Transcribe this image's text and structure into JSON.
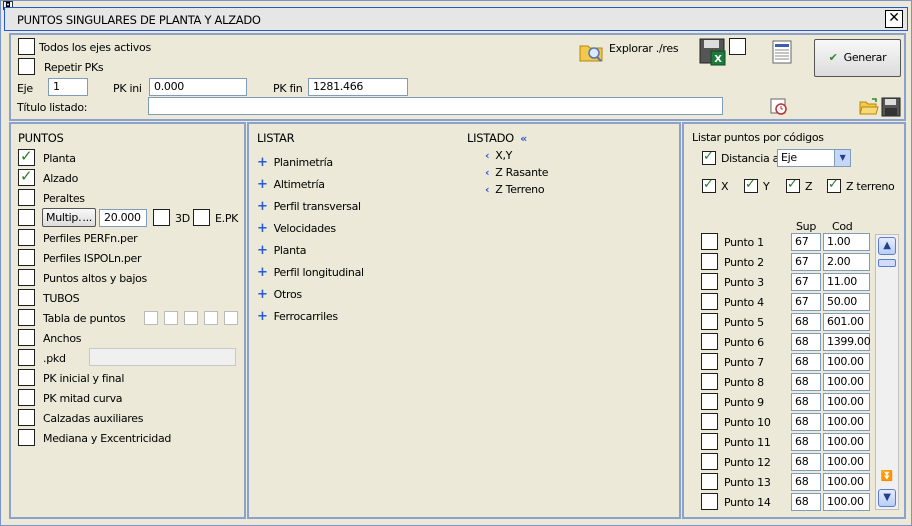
{
  "window": {
    "title": "PUNTOS SINGULARES DE PLANTA Y ALZADO"
  },
  "top": {
    "todos_ejes": "Todos los ejes activos",
    "repetir_pks": "Repetir PKs",
    "eje_label": "Eje",
    "eje_value": "1",
    "pk_ini_label": "PK ini",
    "pk_ini_value": "0.000",
    "pk_fin_label": "PK fin",
    "pk_fin_value": "1281.466",
    "titulo_label": "Título listado:",
    "titulo_value": "",
    "explorar_label": "Explorar ./res",
    "generar_label": "Generar"
  },
  "puntos": {
    "title": "PUNTOS",
    "items": [
      {
        "label": "Planta",
        "checked": true
      },
      {
        "label": "Alzado",
        "checked": true
      },
      {
        "label": "Peraltes",
        "checked": false
      }
    ],
    "multip_label": "Multip.",
    "multip_dots": "...",
    "multip_value": "20.000",
    "label_3d": "3D",
    "label_epk": "E.PK",
    "items2": [
      {
        "label": "Perfiles PERFn.per"
      },
      {
        "label": "Perfiles ISPOLn.per"
      },
      {
        "label": "Puntos altos y bajos"
      },
      {
        "label": "TUBOS"
      },
      {
        "label": "Tabla de puntos"
      },
      {
        "label": "Anchos"
      },
      {
        "label": ".pkd"
      },
      {
        "label": "PK inicial y final"
      },
      {
        "label": "PK mitad curva"
      },
      {
        "label": "Calzadas auxiliares"
      },
      {
        "label": "Mediana y Excentricidad"
      }
    ]
  },
  "listar": {
    "title": "LISTAR",
    "items": [
      "Planimetría",
      "Altimetría",
      "Perfil transversal",
      "Velocidades",
      "Planta",
      "Perfil longitudinal",
      "Otros",
      "Ferrocarriles"
    ],
    "listado_title": "LISTADO",
    "listado_items": [
      "X,Y",
      "Z Rasante",
      "Z Terreno"
    ]
  },
  "codes": {
    "title": "Listar puntos por códigos",
    "distancia_label": "Distancia a",
    "distancia_value": "Eje",
    "axes": [
      "X",
      "Y",
      "Z",
      "Z terreno"
    ],
    "col_sup": "Sup",
    "col_cod": "Cod",
    "rows": [
      {
        "label": "Punto 1",
        "sup": "67",
        "cod": "1.00"
      },
      {
        "label": "Punto 2",
        "sup": "67",
        "cod": "2.00"
      },
      {
        "label": "Punto 3",
        "sup": "67",
        "cod": "11.00"
      },
      {
        "label": "Punto 4",
        "sup": "67",
        "cod": "50.00"
      },
      {
        "label": "Punto 5",
        "sup": "68",
        "cod": "601.00"
      },
      {
        "label": "Punto 6",
        "sup": "68",
        "cod": "1399.00"
      },
      {
        "label": "Punto 7",
        "sup": "68",
        "cod": "100.00"
      },
      {
        "label": "Punto 8",
        "sup": "68",
        "cod": "100.00"
      },
      {
        "label": "Punto 9",
        "sup": "68",
        "cod": "100.00"
      },
      {
        "label": "Punto 10",
        "sup": "68",
        "cod": "100.00"
      },
      {
        "label": "Punto 11",
        "sup": "68",
        "cod": "100.00"
      },
      {
        "label": "Punto 12",
        "sup": "68",
        "cod": "100.00"
      },
      {
        "label": "Punto 13",
        "sup": "68",
        "cod": "100.00"
      },
      {
        "label": "Punto 14",
        "sup": "68",
        "cod": "100.00"
      }
    ]
  }
}
